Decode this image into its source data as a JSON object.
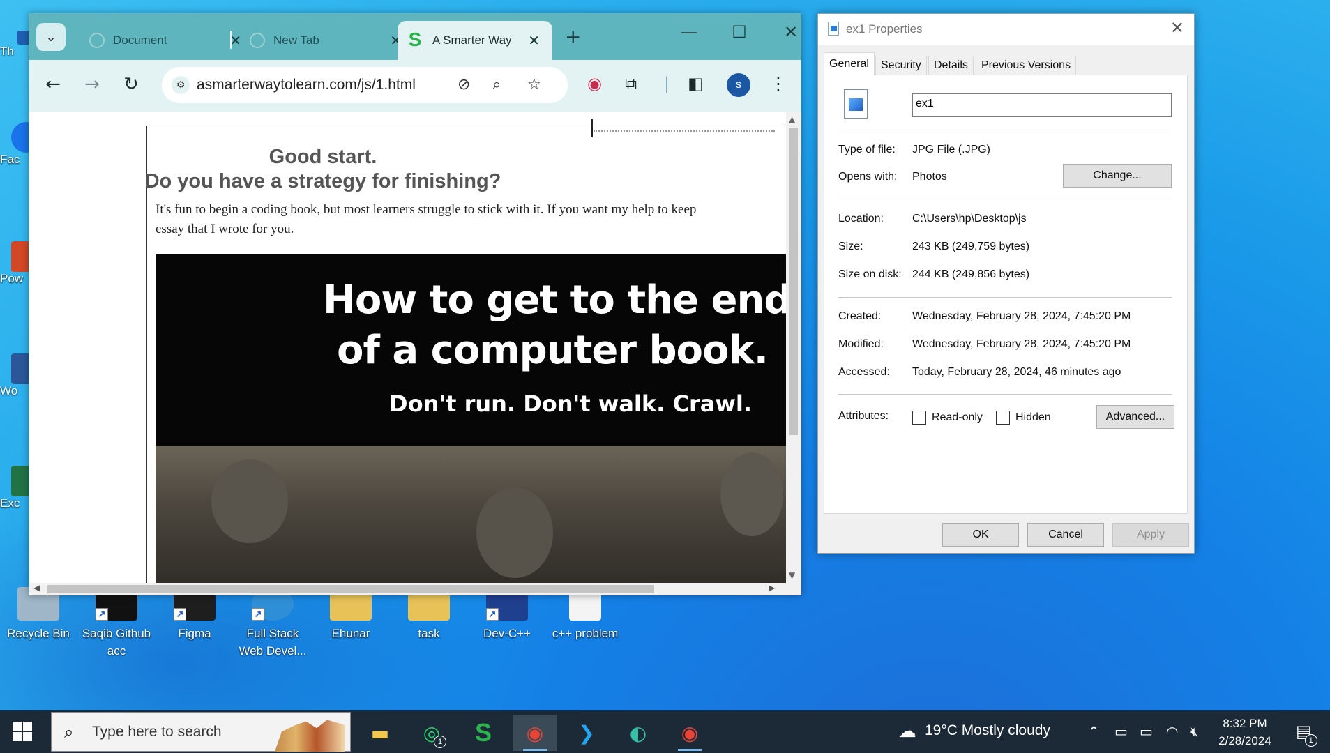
{
  "desktop": {
    "icons": [
      {
        "label": "Recycle Bin",
        "color": "#9fb6c8"
      },
      {
        "label": "Saqib Github acc",
        "color": "#111111"
      },
      {
        "label": "Figma",
        "color": "#1e1e1e"
      },
      {
        "label": "Full Stack Web Devel...",
        "color": "#2f8fd6"
      },
      {
        "label": "Ehunar",
        "color": "#e8c257"
      },
      {
        "label": "task",
        "color": "#e8c257"
      },
      {
        "label": "Dev-C++",
        "color": "#1f3f8f"
      },
      {
        "label": "c++ problem",
        "color": "#f4f4f4"
      }
    ],
    "left_partial": [
      {
        "label": "Th",
        "color": "#1e5fb3"
      },
      {
        "label": "Fac",
        "color": "#1a73e8"
      },
      {
        "label": "Pow",
        "color": "#d24726"
      },
      {
        "label": "Wo",
        "color": "#2b579a"
      },
      {
        "label": "Exc",
        "color": "#217346"
      }
    ]
  },
  "browser": {
    "tabs": [
      {
        "title": "Document"
      },
      {
        "title": "New Tab"
      },
      {
        "title": "A Smarter Way"
      }
    ],
    "active_tab_favicon": "S",
    "url": "asmarterwaytolearn.com/js/1.html",
    "profile_initial": "s",
    "page": {
      "heading1": "Good start.",
      "heading2": "Do you have a strategy for finishing?",
      "intro_line1": "It's fun to begin a coding book, but most learners struggle to stick with it. If you want my help to keep",
      "intro_line2": "essay that I wrote for you.",
      "banner_line1": "How to get to the end",
      "banner_line2": "of a computer book.",
      "banner_line3": "Don't run. Don't walk. Crawl."
    }
  },
  "dialog": {
    "title": "ex1 Properties",
    "tabs": [
      "General",
      "Security",
      "Details",
      "Previous Versions"
    ],
    "filename": "ex1",
    "type_label": "Type of file:",
    "type_value": "JPG File (.JPG)",
    "opens_label": "Opens with:",
    "opens_value": "Photos",
    "change_button": "Change...",
    "location_label": "Location:",
    "location_value": "C:\\Users\\hp\\Desktop\\js",
    "size_label": "Size:",
    "size_value": "243 KB (249,759 bytes)",
    "sizedisk_label": "Size on disk:",
    "sizedisk_value": "244 KB (249,856 bytes)",
    "created_label": "Created:",
    "created_value": "Wednesday, February 28, 2024, 7:45:20 PM",
    "modified_label": "Modified:",
    "modified_value": "Wednesday, February 28, 2024, 7:45:20 PM",
    "accessed_label": "Accessed:",
    "accessed_value": "Today, February 28, 2024, 46 minutes ago",
    "attributes_label": "Attributes:",
    "readonly_label": "Read-only",
    "hidden_label": "Hidden",
    "advanced_button": "Advanced...",
    "ok_button": "OK",
    "cancel_button": "Cancel",
    "apply_button": "Apply"
  },
  "taskbar": {
    "search_placeholder": "Type here to search",
    "whatsapp_badge": "1",
    "weather": "19°C  Mostly cloudy",
    "time": "8:32 PM",
    "date": "2/28/2024",
    "notification_badge": "1"
  }
}
